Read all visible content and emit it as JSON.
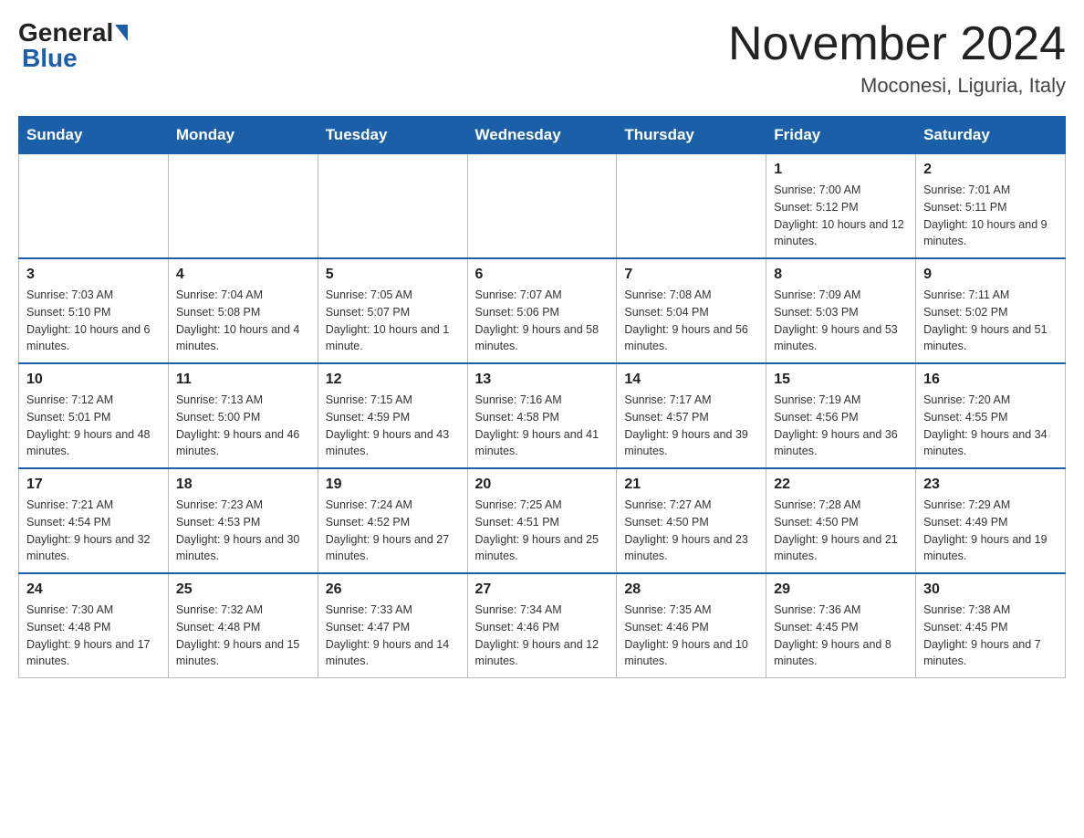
{
  "header": {
    "logo_general": "General",
    "logo_blue": "Blue",
    "title": "November 2024",
    "subtitle": "Moconesi, Liguria, Italy"
  },
  "days_header": [
    "Sunday",
    "Monday",
    "Tuesday",
    "Wednesday",
    "Thursday",
    "Friday",
    "Saturday"
  ],
  "weeks": [
    [
      {
        "day": "",
        "sunrise": "",
        "sunset": "",
        "daylight": ""
      },
      {
        "day": "",
        "sunrise": "",
        "sunset": "",
        "daylight": ""
      },
      {
        "day": "",
        "sunrise": "",
        "sunset": "",
        "daylight": ""
      },
      {
        "day": "",
        "sunrise": "",
        "sunset": "",
        "daylight": ""
      },
      {
        "day": "",
        "sunrise": "",
        "sunset": "",
        "daylight": ""
      },
      {
        "day": "1",
        "sunrise": "Sunrise: 7:00 AM",
        "sunset": "Sunset: 5:12 PM",
        "daylight": "Daylight: 10 hours and 12 minutes."
      },
      {
        "day": "2",
        "sunrise": "Sunrise: 7:01 AM",
        "sunset": "Sunset: 5:11 PM",
        "daylight": "Daylight: 10 hours and 9 minutes."
      }
    ],
    [
      {
        "day": "3",
        "sunrise": "Sunrise: 7:03 AM",
        "sunset": "Sunset: 5:10 PM",
        "daylight": "Daylight: 10 hours and 6 minutes."
      },
      {
        "day": "4",
        "sunrise": "Sunrise: 7:04 AM",
        "sunset": "Sunset: 5:08 PM",
        "daylight": "Daylight: 10 hours and 4 minutes."
      },
      {
        "day": "5",
        "sunrise": "Sunrise: 7:05 AM",
        "sunset": "Sunset: 5:07 PM",
        "daylight": "Daylight: 10 hours and 1 minute."
      },
      {
        "day": "6",
        "sunrise": "Sunrise: 7:07 AM",
        "sunset": "Sunset: 5:06 PM",
        "daylight": "Daylight: 9 hours and 58 minutes."
      },
      {
        "day": "7",
        "sunrise": "Sunrise: 7:08 AM",
        "sunset": "Sunset: 5:04 PM",
        "daylight": "Daylight: 9 hours and 56 minutes."
      },
      {
        "day": "8",
        "sunrise": "Sunrise: 7:09 AM",
        "sunset": "Sunset: 5:03 PM",
        "daylight": "Daylight: 9 hours and 53 minutes."
      },
      {
        "day": "9",
        "sunrise": "Sunrise: 7:11 AM",
        "sunset": "Sunset: 5:02 PM",
        "daylight": "Daylight: 9 hours and 51 minutes."
      }
    ],
    [
      {
        "day": "10",
        "sunrise": "Sunrise: 7:12 AM",
        "sunset": "Sunset: 5:01 PM",
        "daylight": "Daylight: 9 hours and 48 minutes."
      },
      {
        "day": "11",
        "sunrise": "Sunrise: 7:13 AM",
        "sunset": "Sunset: 5:00 PM",
        "daylight": "Daylight: 9 hours and 46 minutes."
      },
      {
        "day": "12",
        "sunrise": "Sunrise: 7:15 AM",
        "sunset": "Sunset: 4:59 PM",
        "daylight": "Daylight: 9 hours and 43 minutes."
      },
      {
        "day": "13",
        "sunrise": "Sunrise: 7:16 AM",
        "sunset": "Sunset: 4:58 PM",
        "daylight": "Daylight: 9 hours and 41 minutes."
      },
      {
        "day": "14",
        "sunrise": "Sunrise: 7:17 AM",
        "sunset": "Sunset: 4:57 PM",
        "daylight": "Daylight: 9 hours and 39 minutes."
      },
      {
        "day": "15",
        "sunrise": "Sunrise: 7:19 AM",
        "sunset": "Sunset: 4:56 PM",
        "daylight": "Daylight: 9 hours and 36 minutes."
      },
      {
        "day": "16",
        "sunrise": "Sunrise: 7:20 AM",
        "sunset": "Sunset: 4:55 PM",
        "daylight": "Daylight: 9 hours and 34 minutes."
      }
    ],
    [
      {
        "day": "17",
        "sunrise": "Sunrise: 7:21 AM",
        "sunset": "Sunset: 4:54 PM",
        "daylight": "Daylight: 9 hours and 32 minutes."
      },
      {
        "day": "18",
        "sunrise": "Sunrise: 7:23 AM",
        "sunset": "Sunset: 4:53 PM",
        "daylight": "Daylight: 9 hours and 30 minutes."
      },
      {
        "day": "19",
        "sunrise": "Sunrise: 7:24 AM",
        "sunset": "Sunset: 4:52 PM",
        "daylight": "Daylight: 9 hours and 27 minutes."
      },
      {
        "day": "20",
        "sunrise": "Sunrise: 7:25 AM",
        "sunset": "Sunset: 4:51 PM",
        "daylight": "Daylight: 9 hours and 25 minutes."
      },
      {
        "day": "21",
        "sunrise": "Sunrise: 7:27 AM",
        "sunset": "Sunset: 4:50 PM",
        "daylight": "Daylight: 9 hours and 23 minutes."
      },
      {
        "day": "22",
        "sunrise": "Sunrise: 7:28 AM",
        "sunset": "Sunset: 4:50 PM",
        "daylight": "Daylight: 9 hours and 21 minutes."
      },
      {
        "day": "23",
        "sunrise": "Sunrise: 7:29 AM",
        "sunset": "Sunset: 4:49 PM",
        "daylight": "Daylight: 9 hours and 19 minutes."
      }
    ],
    [
      {
        "day": "24",
        "sunrise": "Sunrise: 7:30 AM",
        "sunset": "Sunset: 4:48 PM",
        "daylight": "Daylight: 9 hours and 17 minutes."
      },
      {
        "day": "25",
        "sunrise": "Sunrise: 7:32 AM",
        "sunset": "Sunset: 4:48 PM",
        "daylight": "Daylight: 9 hours and 15 minutes."
      },
      {
        "day": "26",
        "sunrise": "Sunrise: 7:33 AM",
        "sunset": "Sunset: 4:47 PM",
        "daylight": "Daylight: 9 hours and 14 minutes."
      },
      {
        "day": "27",
        "sunrise": "Sunrise: 7:34 AM",
        "sunset": "Sunset: 4:46 PM",
        "daylight": "Daylight: 9 hours and 12 minutes."
      },
      {
        "day": "28",
        "sunrise": "Sunrise: 7:35 AM",
        "sunset": "Sunset: 4:46 PM",
        "daylight": "Daylight: 9 hours and 10 minutes."
      },
      {
        "day": "29",
        "sunrise": "Sunrise: 7:36 AM",
        "sunset": "Sunset: 4:45 PM",
        "daylight": "Daylight: 9 hours and 8 minutes."
      },
      {
        "day": "30",
        "sunrise": "Sunrise: 7:38 AM",
        "sunset": "Sunset: 4:45 PM",
        "daylight": "Daylight: 9 hours and 7 minutes."
      }
    ]
  ]
}
